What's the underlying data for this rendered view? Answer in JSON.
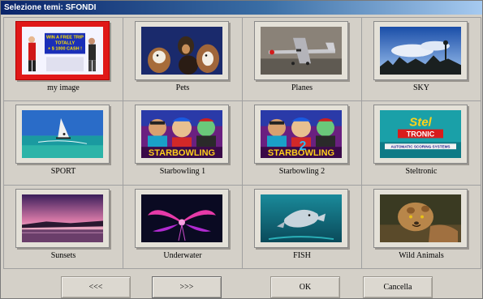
{
  "window": {
    "title": "Selezione temi: SFONDI"
  },
  "themes": [
    {
      "label": "my image",
      "selected": true,
      "poster": [
        "WIN A FREE TRIP",
        "TOTALLY",
        "+ $ 1000 CASH !"
      ]
    },
    {
      "label": "Pets",
      "selected": false
    },
    {
      "label": "Planes",
      "selected": false
    },
    {
      "label": "SKY",
      "selected": false
    },
    {
      "label": "SPORT",
      "selected": false
    },
    {
      "label": "Starbowling 1",
      "selected": false,
      "logo": "STARBOWLING"
    },
    {
      "label": "Starbowling 2",
      "selected": false,
      "logo": "STARBOWLING",
      "badge": "2"
    },
    {
      "label": "Steltronic",
      "selected": false,
      "logo": "Stel",
      "logo2": "TRONIC",
      "tagline": "AUTOMATIC SCORING SYSTEMS"
    },
    {
      "label": "Sunsets",
      "selected": false
    },
    {
      "label": "Underwater",
      "selected": false
    },
    {
      "label": "FISH",
      "selected": false
    },
    {
      "label": "Wild Animals",
      "selected": false
    }
  ],
  "buttons": {
    "prev": "<<<",
    "next": ">>>",
    "ok": "OK",
    "cancel": "Cancella"
  },
  "colors": {
    "title_bar": "#0a246a",
    "selection": "#e01818",
    "window_bg": "#d4d0c8"
  }
}
